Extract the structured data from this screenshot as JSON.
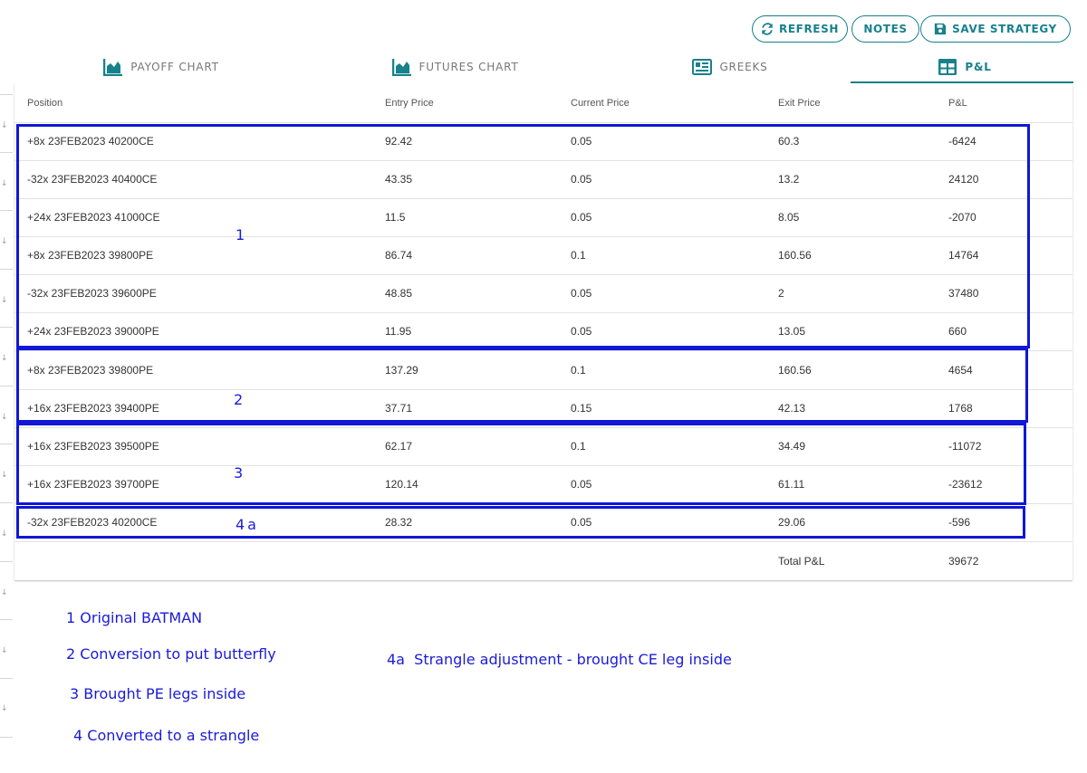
{
  "toolbar": {
    "refresh_label": "Refresh",
    "notes_label": "Notes",
    "save_label": "Save Strategy",
    "accent": "#17818c"
  },
  "tabs": [
    {
      "label": "Payoff Chart",
      "icon": "area-chart-icon"
    },
    {
      "label": "Futures Chart",
      "icon": "area-chart-icon"
    },
    {
      "label": "Greeks",
      "icon": "newspaper-icon"
    },
    {
      "label": "P&L",
      "icon": "table-icon",
      "active": true
    }
  ],
  "table": {
    "columns": [
      "Position",
      "Entry Price",
      "Current Price",
      "Exit Price",
      "P&L"
    ],
    "rows": [
      {
        "position": "+8x 23FEB2023 40200CE",
        "entry": "92.42",
        "current": "0.05",
        "exit": "60.3",
        "pnl": "-6424"
      },
      {
        "position": "-32x 23FEB2023 40400CE",
        "entry": "43.35",
        "current": "0.05",
        "exit": "13.2",
        "pnl": "24120"
      },
      {
        "position": "+24x 23FEB2023 41000CE",
        "entry": "11.5",
        "current": "0.05",
        "exit": "8.05",
        "pnl": "-2070"
      },
      {
        "position": "+8x 23FEB2023 39800PE",
        "entry": "86.74",
        "current": "0.1",
        "exit": "160.56",
        "pnl": "14764"
      },
      {
        "position": "-32x 23FEB2023 39600PE",
        "entry": "48.85",
        "current": "0.05",
        "exit": "2",
        "pnl": "37480"
      },
      {
        "position": "+24x 23FEB2023 39000PE",
        "entry": "11.95",
        "current": "0.05",
        "exit": "13.05",
        "pnl": "660"
      },
      {
        "position": "+8x 23FEB2023 39800PE",
        "entry": "137.29",
        "current": "0.1",
        "exit": "160.56",
        "pnl": "4654"
      },
      {
        "position": "+16x 23FEB2023 39400PE",
        "entry": "37.71",
        "current": "0.15",
        "exit": "42.13",
        "pnl": "1768"
      },
      {
        "position": "+16x 23FEB2023 39500PE",
        "entry": "62.17",
        "current": "0.1",
        "exit": "34.49",
        "pnl": "-11072"
      },
      {
        "position": "+16x 23FEB2023 39700PE",
        "entry": "120.14",
        "current": "0.05",
        "exit": "61.11",
        "pnl": "-23612"
      },
      {
        "position": "-32x 23FEB2023 40200CE",
        "entry": "28.32",
        "current": "0.05",
        "exit": "29.06",
        "pnl": "-596"
      }
    ],
    "total_label": "Total P&L",
    "total_value": "39672"
  },
  "annotations": {
    "color": "#1017d6",
    "group_labels": [
      "1",
      "2",
      "3",
      "4a"
    ],
    "notes": [
      "1 Original BATMAN",
      "2 Conversion to put butterfly",
      "3 Brought PE legs inside",
      "4 Converted to a strangle",
      "4a  Strangle adjustment - brought CE leg inside"
    ]
  }
}
